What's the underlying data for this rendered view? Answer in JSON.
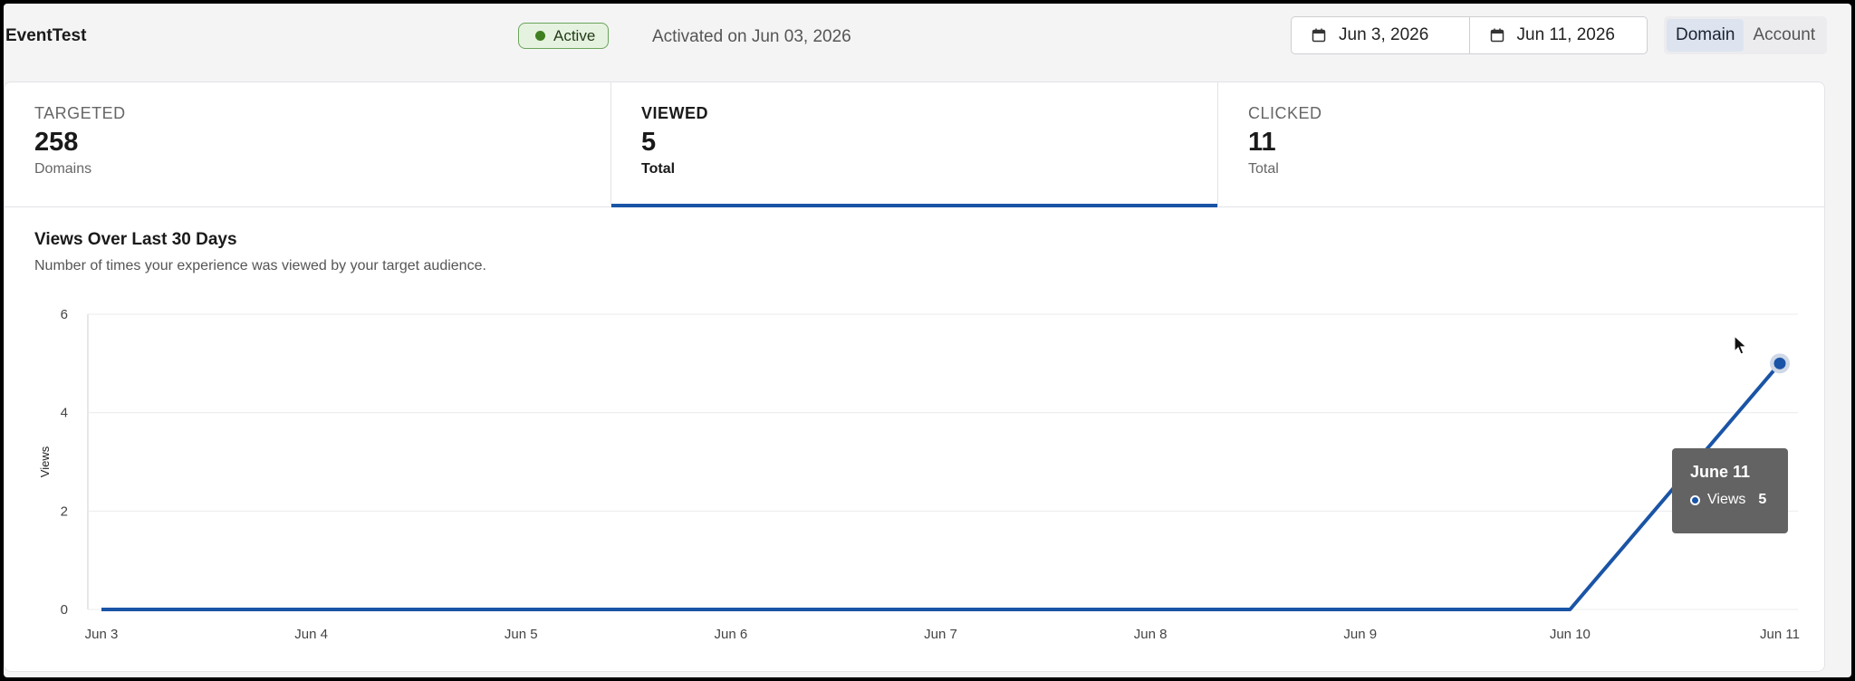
{
  "header": {
    "title": "EventTest",
    "status": "Active",
    "activated_text": "Activated on Jun 03, 2026",
    "date_start": "Jun 3, 2026",
    "date_end": "Jun 11, 2026",
    "scope_options": [
      "Domain",
      "Account"
    ],
    "scope_selected": "Domain"
  },
  "metrics": [
    {
      "label": "TARGETED",
      "value": "258",
      "unit": "Domains",
      "selected": false
    },
    {
      "label": "VIEWED",
      "value": "5",
      "unit": "Total",
      "selected": true
    },
    {
      "label": "CLICKED",
      "value": "11",
      "unit": "Total",
      "selected": false
    }
  ],
  "chart": {
    "title": "Views Over Last 30 Days",
    "subtitle": "Number of times your experience was viewed by your target audience."
  },
  "tooltip": {
    "date": "June 11",
    "series": "Views",
    "value": "5"
  },
  "colors": {
    "accent": "#1a54a6",
    "active_green": "#3f7f1f",
    "tooltip_bg": "#636363"
  },
  "chart_data": {
    "type": "line",
    "x": [
      "Jun 3",
      "Jun 4",
      "Jun 5",
      "Jun 6",
      "Jun 7",
      "Jun 8",
      "Jun 9",
      "Jun 10",
      "Jun 11"
    ],
    "series": [
      {
        "name": "Views",
        "values": [
          0,
          0,
          0,
          0,
          0,
          0,
          0,
          0,
          5
        ]
      }
    ],
    "ylabel": "Views",
    "ylim": [
      0,
      6
    ],
    "yticks": [
      0,
      2,
      4,
      6
    ],
    "grid": true
  }
}
